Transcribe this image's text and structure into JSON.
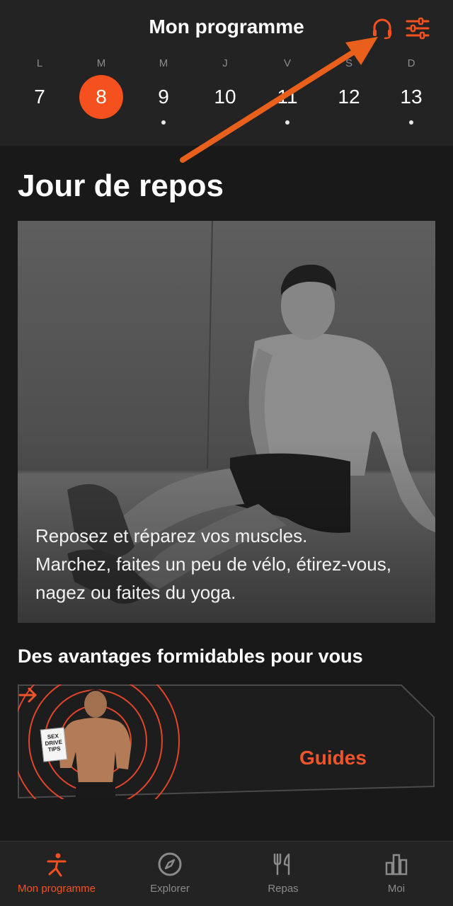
{
  "header": {
    "title": "Mon programme",
    "headset_icon": "headset-icon",
    "filters_icon": "sliders-icon"
  },
  "week": [
    {
      "letter": "L",
      "num": "7",
      "active": false,
      "dot": false
    },
    {
      "letter": "M",
      "num": "8",
      "active": true,
      "dot": false
    },
    {
      "letter": "M",
      "num": "9",
      "active": false,
      "dot": true
    },
    {
      "letter": "J",
      "num": "10",
      "active": false,
      "dot": false
    },
    {
      "letter": "V",
      "num": "11",
      "active": false,
      "dot": true
    },
    {
      "letter": "S",
      "num": "12",
      "active": false,
      "dot": false
    },
    {
      "letter": "D",
      "num": "13",
      "active": false,
      "dot": true
    }
  ],
  "main": {
    "title": "Jour de repos",
    "hero_text": "Reposez et réparez vos muscles.\n Marchez, faites un peu de vélo, étirez-vous, nagez ou faites du yoga.",
    "benefits_title": "Des avantages formidables pour vous",
    "guides_label": "Guides",
    "book_text": "SEX DRIVE TIPS"
  },
  "tabs": [
    {
      "label": "Mon programme",
      "icon": "person-exercise-icon",
      "active": true
    },
    {
      "label": "Explorer",
      "icon": "compass-icon",
      "active": false
    },
    {
      "label": "Repas",
      "icon": "fork-knife-icon",
      "active": false
    },
    {
      "label": "Moi",
      "icon": "bar-chart-icon",
      "active": false
    }
  ],
  "colors": {
    "accent": "#f4511e",
    "background": "#191919",
    "surface": "#232323"
  }
}
